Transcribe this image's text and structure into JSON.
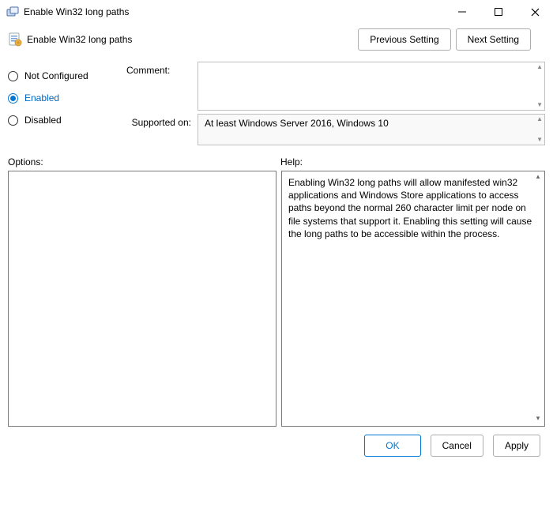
{
  "window": {
    "title": "Enable Win32 long paths"
  },
  "header": {
    "title": "Enable Win32 long paths",
    "prev": "Previous Setting",
    "next": "Next Setting"
  },
  "radios": {
    "not_configured": "Not Configured",
    "enabled": "Enabled",
    "disabled": "Disabled"
  },
  "meta": {
    "comment_label": "Comment:",
    "comment_value": "",
    "supported_label": "Supported on:",
    "supported_value": "At least Windows Server 2016, Windows 10"
  },
  "panes": {
    "options_label": "Options:",
    "help_label": "Help:",
    "help_text": "Enabling Win32 long paths will allow manifested win32 applications and Windows Store applications to access paths beyond the normal 260 character limit per node on file systems that support it.  Enabling this setting will cause the long paths to be accessible within the process."
  },
  "footer": {
    "ok": "OK",
    "cancel": "Cancel",
    "apply": "Apply"
  }
}
